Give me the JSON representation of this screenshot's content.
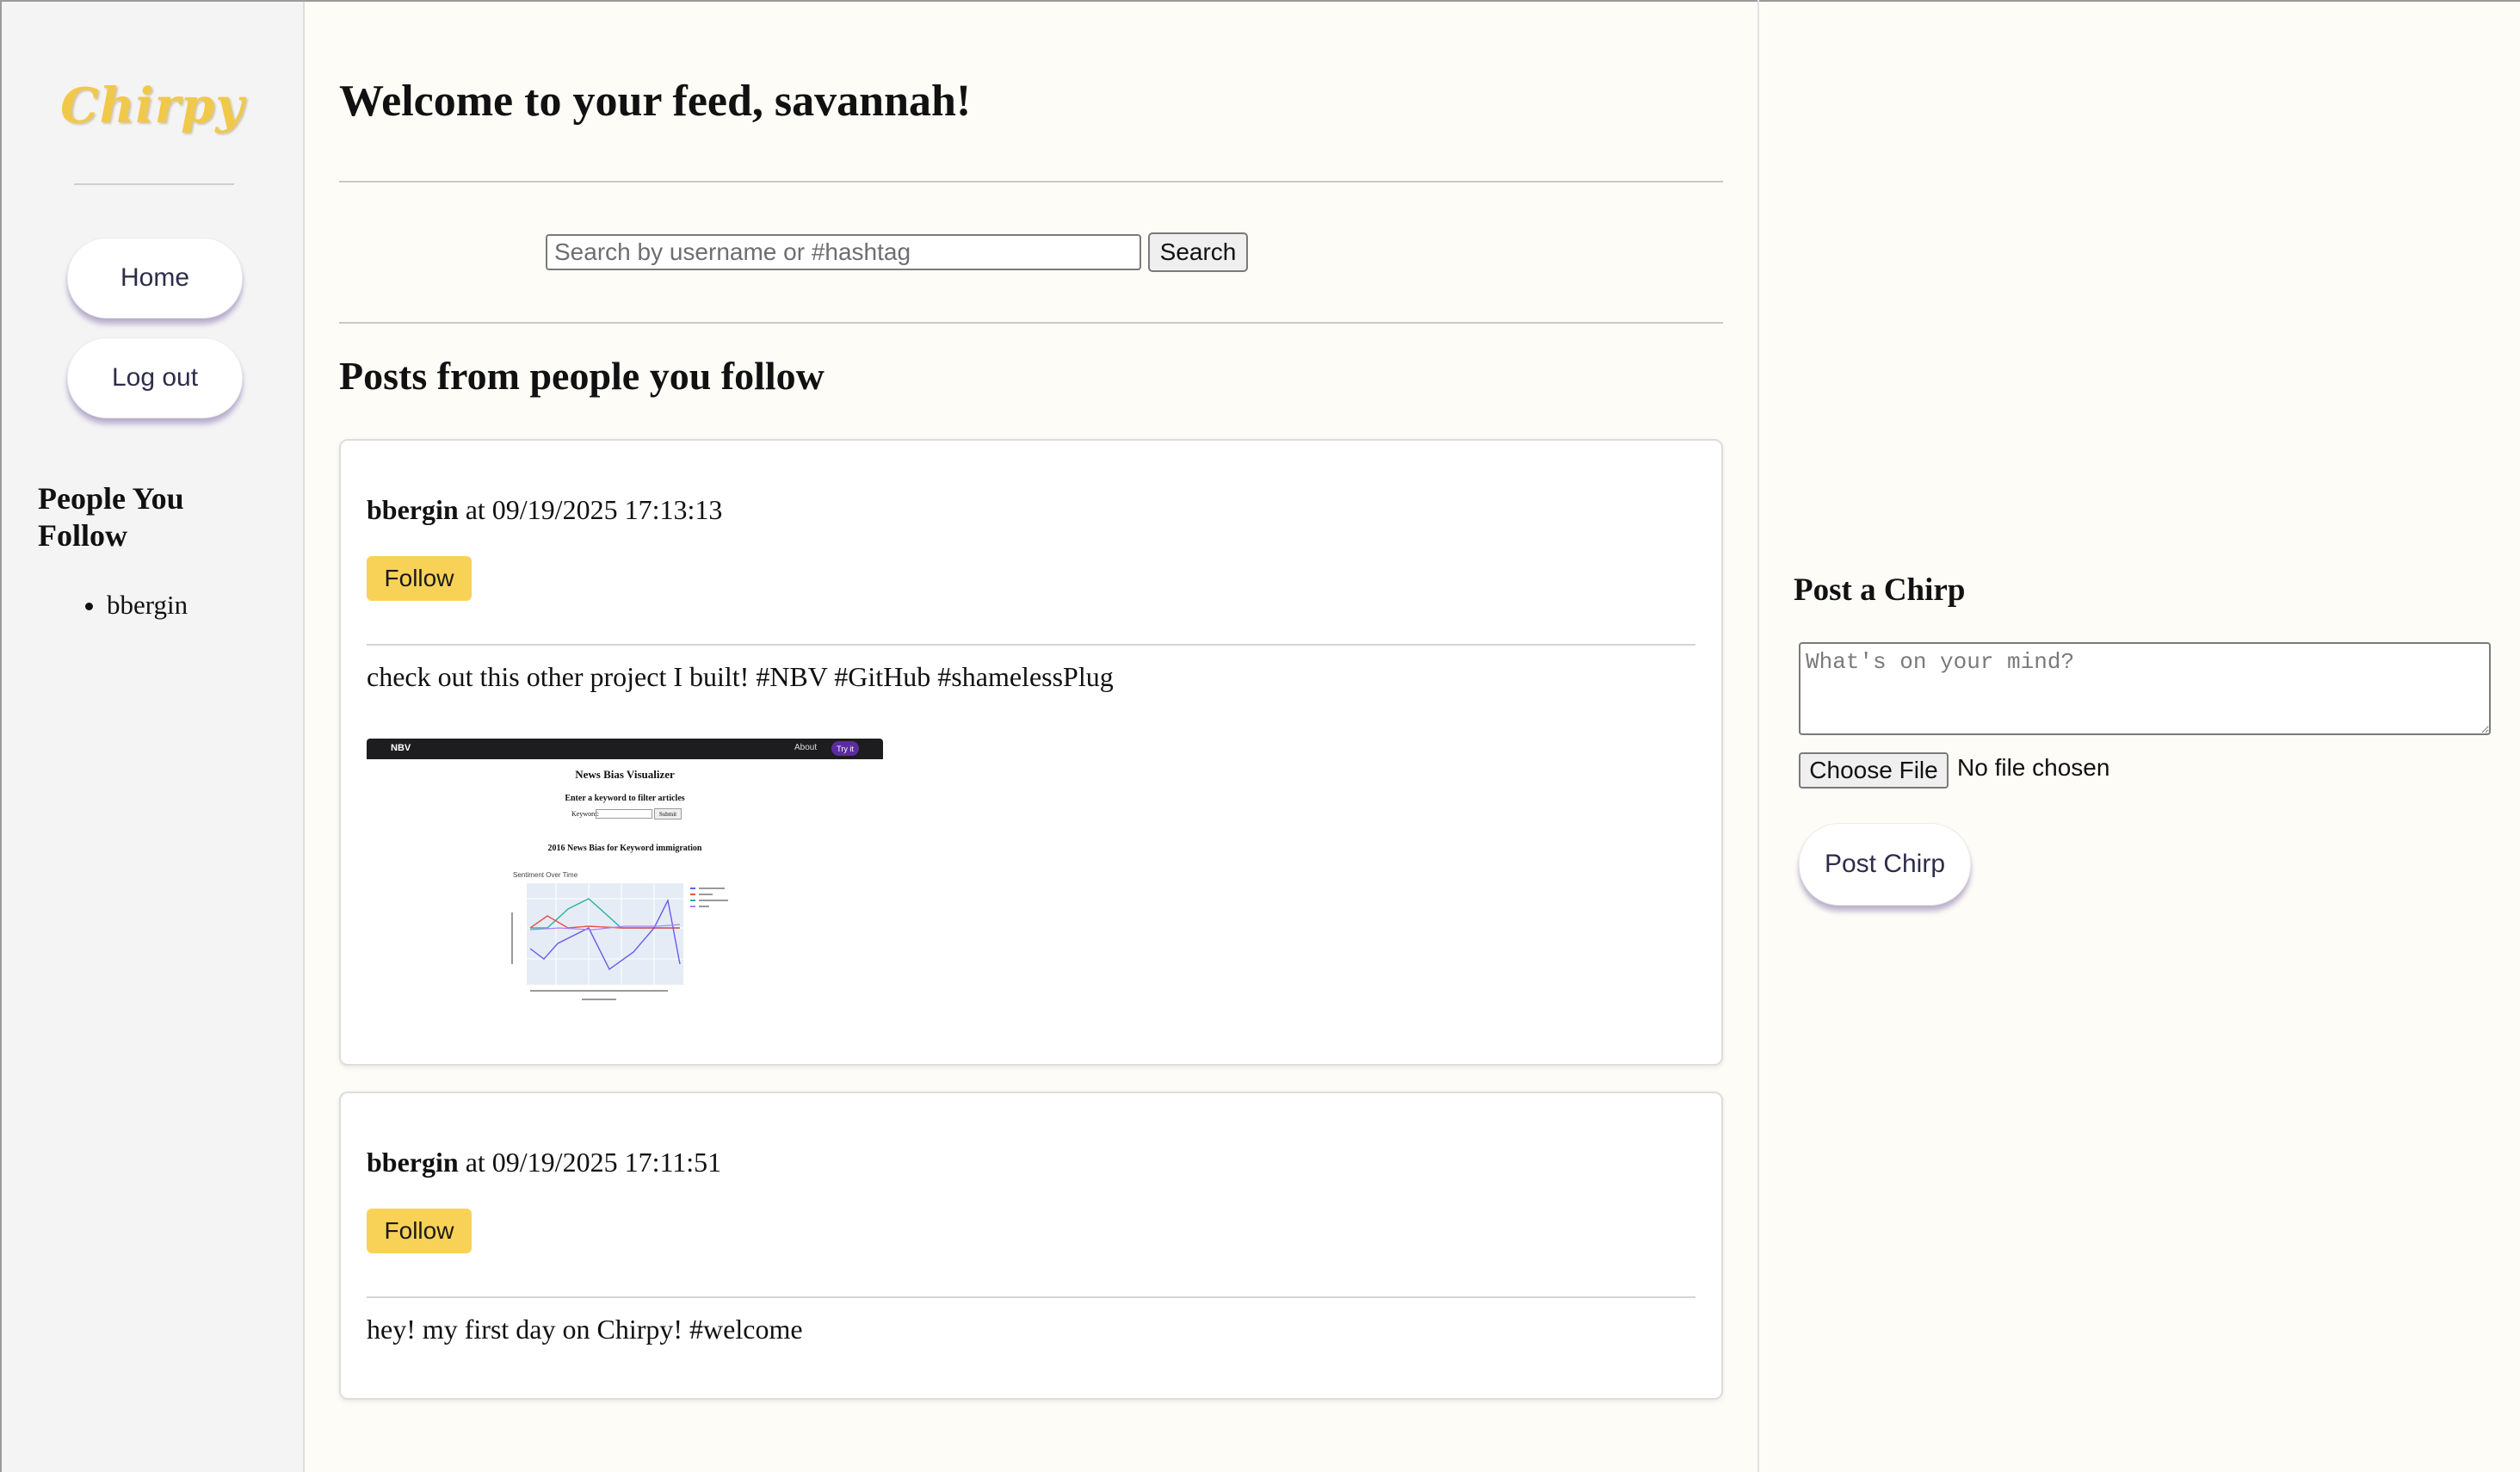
{
  "app": {
    "logo": "Chirpy"
  },
  "sidebar": {
    "nav": [
      {
        "label": "Home"
      },
      {
        "label": "Log out"
      }
    ],
    "following_heading": "People You Follow",
    "following": [
      "bbergin"
    ]
  },
  "feed": {
    "welcome": "Welcome to your feed, savannah!",
    "search": {
      "placeholder": "Search by username or #hashtag",
      "value": "",
      "button": "Search"
    },
    "posts_heading": "Posts from people you follow",
    "posts": [
      {
        "author": "bbergin",
        "connector": "at",
        "timestamp": "09/19/2025 17:13:13",
        "follow_label": "Follow",
        "text": "check out this other project I built! #NBV #GitHub #shamelessPlug",
        "image": {
          "nav_brand": "NBV",
          "nav_about": "About",
          "nav_button": "Try it",
          "title": "News Bias Visualizer",
          "subtitle": "Enter a keyword to filter articles",
          "keyword_label": "Keyword:",
          "submit": "Submit",
          "chart_title": "2016 News Bias for Keyword immigration",
          "plot_label": "Sentiment Over Time"
        }
      },
      {
        "author": "bbergin",
        "connector": "at",
        "timestamp": "09/19/2025 17:11:51",
        "follow_label": "Follow",
        "text": "hey! my first day on Chirpy! #welcome"
      }
    ]
  },
  "composer": {
    "heading": "Post a Chirp",
    "placeholder": "What's on your mind?",
    "choose_file": "Choose File",
    "file_status": "No file chosen",
    "submit": "Post Chirp"
  },
  "colors": {
    "accent_yellow": "#f8d257",
    "logo": "#f0c94a",
    "button_shadow": "#806aaa",
    "background": "#fdfcf7"
  }
}
